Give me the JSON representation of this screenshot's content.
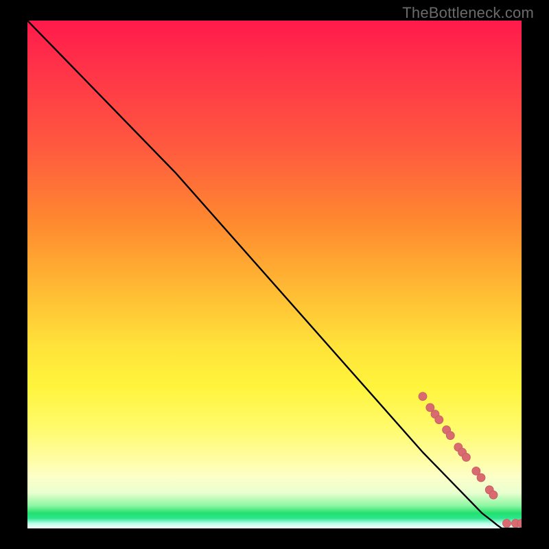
{
  "attribution": "TheBottleneck.com",
  "colors": {
    "line": "#000000",
    "marker_fill": "#d96a6f",
    "marker_stroke": "#c25a60"
  },
  "chart_data": {
    "type": "line",
    "title": "",
    "xlabel": "",
    "ylabel": "",
    "xlim": [
      0,
      100
    ],
    "ylim": [
      0,
      100
    ],
    "grid": false,
    "series": [
      {
        "name": "curve",
        "x": [
          0,
          10,
          20,
          30,
          40,
          50,
          60,
          70,
          80,
          82,
          84,
          86,
          88,
          90,
          92,
          94,
          95,
          96,
          98,
          100
        ],
        "y": [
          100,
          90,
          80,
          70,
          59,
          48,
          37,
          26,
          15,
          13,
          11,
          9,
          7,
          5,
          3,
          1.5,
          0.7,
          0,
          0,
          0
        ]
      }
    ],
    "markers": [
      {
        "x": 80.0,
        "y": 26.0,
        "r": 6
      },
      {
        "x": 81.5,
        "y": 23.8,
        "r": 6
      },
      {
        "x": 82.5,
        "y": 22.5,
        "r": 6
      },
      {
        "x": 83.3,
        "y": 21.4,
        "r": 6
      },
      {
        "x": 84.8,
        "y": 19.4,
        "r": 6
      },
      {
        "x": 85.6,
        "y": 18.3,
        "r": 6
      },
      {
        "x": 87.2,
        "y": 16.0,
        "r": 6
      },
      {
        "x": 88.0,
        "y": 15.0,
        "r": 6
      },
      {
        "x": 88.8,
        "y": 14.0,
        "r": 6
      },
      {
        "x": 90.8,
        "y": 11.3,
        "r": 6
      },
      {
        "x": 91.8,
        "y": 10.0,
        "r": 6
      },
      {
        "x": 93.5,
        "y": 7.6,
        "r": 6
      },
      {
        "x": 94.3,
        "y": 6.6,
        "r": 6
      },
      {
        "x": 97.0,
        "y": 1.0,
        "r": 6
      },
      {
        "x": 98.8,
        "y": 1.0,
        "r": 6
      },
      {
        "x": 100.0,
        "y": 1.0,
        "r": 6
      }
    ]
  }
}
